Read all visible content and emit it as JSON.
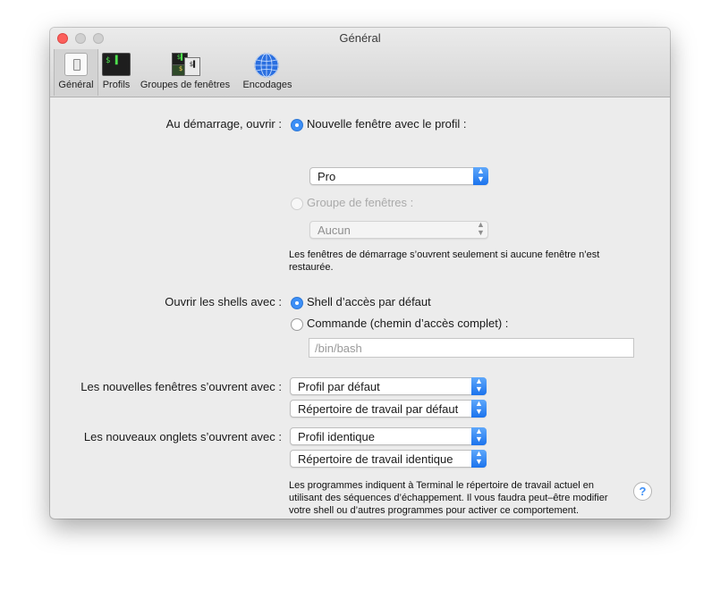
{
  "window": {
    "title": "Général"
  },
  "toolbar": {
    "tabs": [
      {
        "label": "Général",
        "icon": "switch-icon",
        "active": true
      },
      {
        "label": "Profils",
        "icon": "terminal-icon",
        "active": false
      },
      {
        "label": "Groupes de fenêtres",
        "icon": "window-groups-icon",
        "active": false
      },
      {
        "label": "Encodages",
        "icon": "globe-icon",
        "active": false
      }
    ],
    "profils_glyph": "$ ▌",
    "groupes_glyph_a": "$▌",
    "groupes_glyph_b": "$",
    "groupes_glyph_c": "$▌"
  },
  "startup": {
    "label": "Au démarrage, ouvrir :",
    "option_new_window": "Nouvelle fenêtre avec le profil :",
    "profile_value": "Pro",
    "option_group": "Groupe de fenêtres :",
    "group_value": "Aucun",
    "note": "Les fenêtres de démarrage s’ouvrent seulement si aucune fenêtre n’est restaurée."
  },
  "shells": {
    "label": "Ouvrir les shells avec :",
    "option_default": "Shell d’accès par défaut",
    "option_command": "Commande (chemin d’accès complet) :",
    "command_placeholder": "/bin/bash"
  },
  "new_windows": {
    "label": "Les nouvelles fenêtres s’ouvrent avec :",
    "profile_value": "Profil par défaut",
    "directory_value": "Répertoire de travail par défaut"
  },
  "new_tabs": {
    "label": "Les nouveaux onglets s’ouvrent avec :",
    "profile_value": "Profil identique",
    "directory_value": "Répertoire de travail identique"
  },
  "footer_note": "Les programmes indiquent à Terminal le répertoire de travail actuel en utilisant des séquences d’échappement. Il vous faudra peut–être modifier votre shell ou d’autres programmes pour activer ce comportement.",
  "help_label": "?",
  "colors": {
    "accent": "#3b8ef6",
    "close": "#fc605c"
  }
}
